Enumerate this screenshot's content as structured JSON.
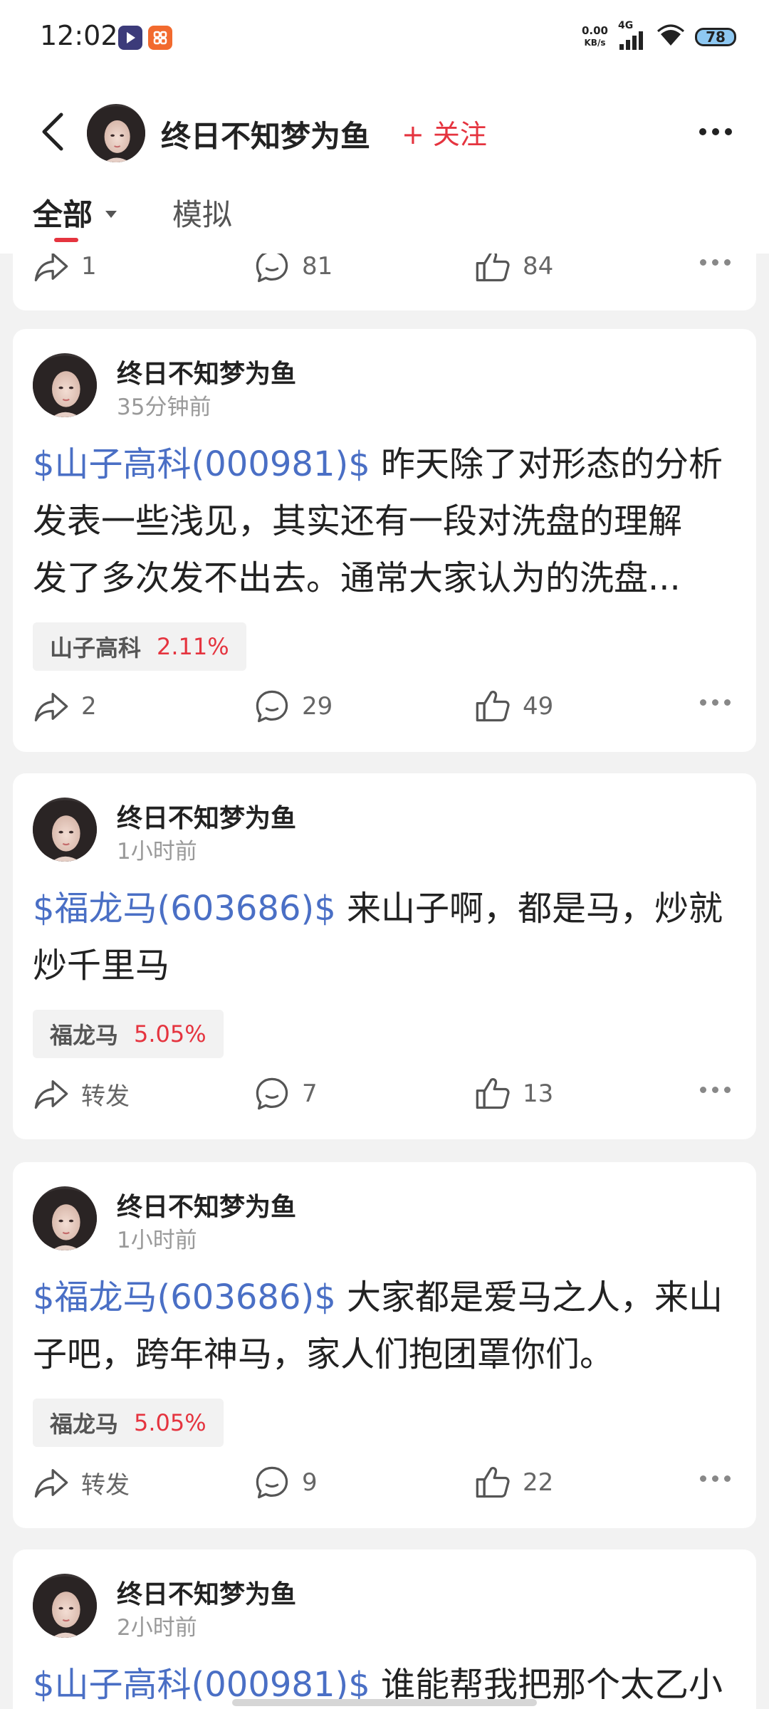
{
  "status_bar": {
    "time": "12:02",
    "speed_value": "0.00",
    "speed_unit": "KB/s",
    "network": "4G",
    "battery": "78",
    "app_icon_1": "video-app-icon",
    "app_icon_2": "shopping-app-icon"
  },
  "header": {
    "user_name": "终日不知梦为鱼",
    "follow_label": "+ 关注"
  },
  "tabs": [
    {
      "label": "全部",
      "active": true
    },
    {
      "label": "模拟",
      "active": false
    }
  ],
  "colors": {
    "accent": "#e5343f",
    "link": "#4a6fc5",
    "gain": "#e5343f"
  },
  "partial_card": {
    "share_count": "1",
    "comment_count": "81",
    "like_count": "84"
  },
  "posts": [
    {
      "user_name": "终日不知梦为鱼",
      "time": "35分钟前",
      "stock_link": "$山子高科(000981)$",
      "text_line1_rest": " 昨天除了对形态的分析",
      "text_line2": "发表一些浅见，其实还有一段对洗盘的理解",
      "text_line3": "发了多次发不出去。通常大家认为的洗盘...",
      "tag_name": "山子高科",
      "tag_pct": "2.11%",
      "share": "2",
      "comment": "29",
      "like": "49"
    },
    {
      "user_name": "终日不知梦为鱼",
      "time": "1小时前",
      "stock_link": "$福龙马(603686)$",
      "text_line1_rest": " 来山子啊，都是马，炒就",
      "text_line2": "炒千里马",
      "tag_name": "福龙马",
      "tag_pct": "5.05%",
      "share": "转发",
      "comment": "7",
      "like": "13"
    },
    {
      "user_name": "终日不知梦为鱼",
      "time": "1小时前",
      "stock_link": "$福龙马(603686)$",
      "text_line1_rest": " 大家都是爱马之人，来山",
      "text_line2": "子吧，跨年神马，家人们抱团罩你们。",
      "tag_name": "福龙马",
      "tag_pct": "5.05%",
      "share": "转发",
      "comment": "9",
      "like": "22"
    },
    {
      "user_name": "终日不知梦为鱼",
      "time": "2小时前",
      "stock_link": "$山子高科(000981)$",
      "text_line1_rest": " 谁能帮我把那个太乙小"
    }
  ]
}
